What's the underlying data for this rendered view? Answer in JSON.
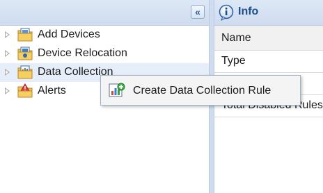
{
  "tree_panel": {
    "collapse_glyph": "«",
    "items": [
      {
        "label": "Add Devices",
        "icon": "folder-devices-icon"
      },
      {
        "label": "Device Relocation",
        "icon": "folder-relocation-icon"
      },
      {
        "label": "Data Collection",
        "icon": "folder-data-collection-icon"
      },
      {
        "label": "Alerts",
        "icon": "folder-alerts-icon"
      }
    ]
  },
  "info_panel": {
    "title": "Info",
    "rows": [
      {
        "label": "Name"
      },
      {
        "label": "Type"
      },
      {
        "label": ""
      },
      {
        "label": "Total Disabled Rules"
      }
    ]
  },
  "context_menu": {
    "items": [
      {
        "label": "Create Data Collection Rule",
        "icon": "add-chart-icon"
      }
    ]
  },
  "colors": {
    "header_bg": "#cfdcef",
    "accent": "#1d4f8c",
    "selected_row": "#e6eef9",
    "menu_bg": "#f4f4f4"
  }
}
